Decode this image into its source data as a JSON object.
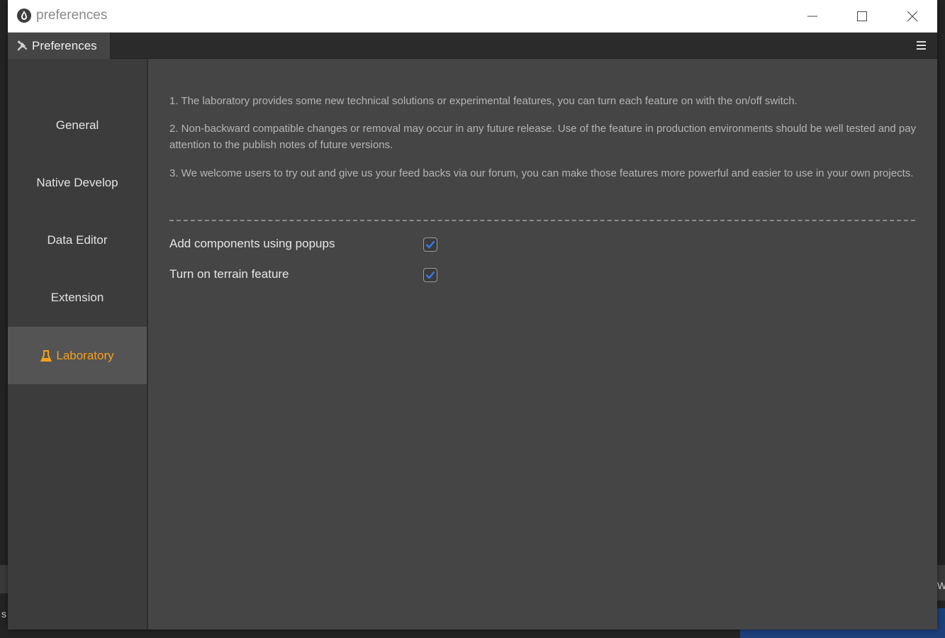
{
  "window": {
    "title": "preferences"
  },
  "tab": {
    "label": "Preferences"
  },
  "sidebar": {
    "items": [
      {
        "label": "General"
      },
      {
        "label": "Native Develop"
      },
      {
        "label": "Data Editor"
      },
      {
        "label": "Extension"
      },
      {
        "label": "Laboratory",
        "active": true
      }
    ]
  },
  "laboratory": {
    "notes": [
      "1. The laboratory provides some new technical solutions or experimental features, you can turn each feature on with the on/off switch.",
      "2. Non-backward compatible changes or removal may occur in any future release. Use of the feature in production environments should be well tested and pay attention to the publish notes of future versions.",
      "3. We welcome users to try out and give us your feed backs via our forum, you can make those features more powerful and easier to use in your own projects."
    ],
    "features": [
      {
        "label": "Add components using popups",
        "checked": true
      },
      {
        "label": "Turn on terrain feature",
        "checked": true
      }
    ]
  },
  "background": {
    "left_text": "s",
    "right_text": "W"
  },
  "colors": {
    "accent": "#f5a11b",
    "checkmark": "#3c78e6",
    "panel": "#454545",
    "sidebar": "#3c3c3c"
  }
}
